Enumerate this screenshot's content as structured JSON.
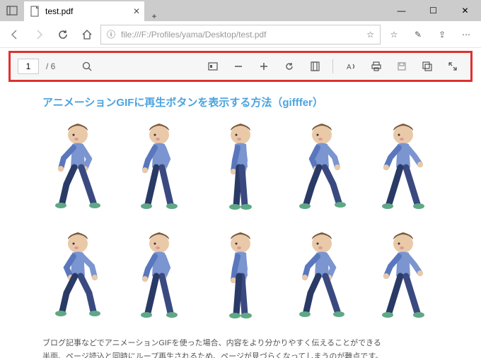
{
  "window": {
    "controls": {
      "min": "—",
      "max": "☐",
      "close": "✕"
    }
  },
  "tab": {
    "title": "test.pdf",
    "close": "✕",
    "newtab": "+"
  },
  "addr": {
    "lock_prefix": "ⓘ",
    "url": "file:///F:/Profiles/yama/Desktop/test.pdf",
    "star": "☆"
  },
  "toolbar_icons": {
    "fav": "☆",
    "notes": "✎",
    "share": "⇪",
    "more": "⋯"
  },
  "pdf": {
    "page": "1",
    "total": "/ 6"
  },
  "doc": {
    "title": "アニメーションGIFに再生ボタンを表示する方法（gifffer）",
    "p1": "ブログ記事などでアニメーションGIFを使った場合、内容をより分かりやすく伝えることができる",
    "p2": "半面、ページ読込と同時にループ再生されるため、ページが見づらくなってしまうのが難点です。"
  }
}
